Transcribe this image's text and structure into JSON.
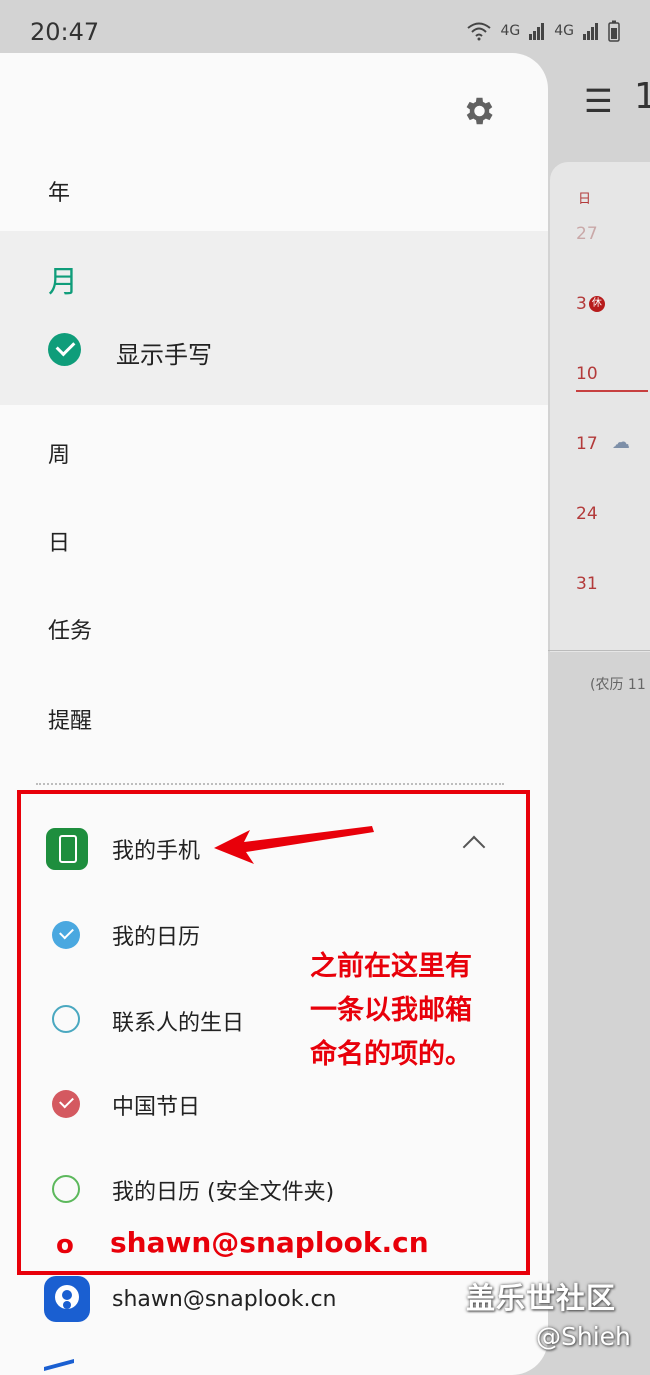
{
  "status_bar": {
    "time": "20:47",
    "net1": "4G",
    "net2": "4G"
  },
  "background_calendar": {
    "title_partial": "1",
    "weekday": "日",
    "days": [
      "27",
      "3",
      "10",
      "17",
      "24",
      "31"
    ],
    "holiday_badge": "休",
    "lunar_partial": "(农历 11"
  },
  "drawer": {
    "views": [
      "年",
      "月",
      "周",
      "日",
      "任务",
      "提醒"
    ],
    "show_handwriting": "显示手写",
    "my_phone": {
      "label": "我的手机",
      "calendars": [
        {
          "label": "我的日历",
          "color": "#4aa8e0",
          "checked": true
        },
        {
          "label": "联系人的生日",
          "color": "#4aa8c0",
          "checked": false
        },
        {
          "label": "中国节日",
          "color": "#d45960",
          "checked": true
        },
        {
          "label": "我的日历 (安全文件夹)",
          "color": "#5cb85c",
          "checked": false
        }
      ]
    },
    "account": {
      "label": "shawn@snaplook.cn"
    }
  },
  "annotations": {
    "note": "之前在这里有一条以我邮箱命名的项的。",
    "o_mark": "o",
    "email": "shawn@snaplook.cn",
    "color": "#e8000a"
  },
  "watermark": {
    "line1": "盖乐世社区",
    "line2": "@Shieh"
  }
}
